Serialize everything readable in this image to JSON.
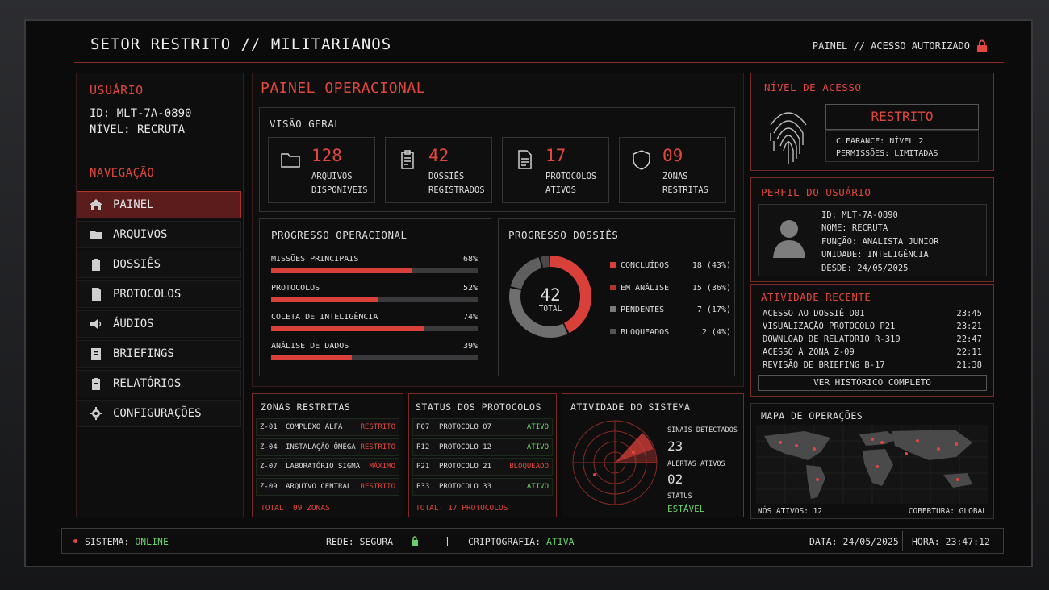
{
  "header": {
    "title": "SETOR RESTRITO // MILITARIANOS",
    "access": "PAINEL // ACESSO AUTORIZADO"
  },
  "user": {
    "heading": "USUÁRIO",
    "id": "ID: MLT-7A-0890",
    "level": "NÍVEL: RECRUTA"
  },
  "nav": {
    "heading": "NAVEGAÇÃO",
    "items": [
      {
        "label": "PAINEL",
        "icon": "home-icon"
      },
      {
        "label": "ARQUIVOS",
        "icon": "folder-icon"
      },
      {
        "label": "DOSSIÊS",
        "icon": "clipboard-icon"
      },
      {
        "label": "PROTOCOLOS",
        "icon": "document-icon"
      },
      {
        "label": "ÁUDIOS",
        "icon": "speaker-icon"
      },
      {
        "label": "BRIEFINGS",
        "icon": "briefing-icon"
      },
      {
        "label": "RELATÓRIOS",
        "icon": "report-icon"
      },
      {
        "label": "CONFIGURAÇÕES",
        "icon": "gear-icon"
      }
    ]
  },
  "main": {
    "title": "PAINEL OPERACIONAL",
    "overview": {
      "heading": "VISÃO GERAL",
      "stats": [
        {
          "value": "128",
          "line1": "ARQUIVOS",
          "line2": "DISPONÍVEIS",
          "icon": "folder-icon"
        },
        {
          "value": "42",
          "line1": "DOSSIÊS",
          "line2": "REGISTRADOS",
          "icon": "clipboard-icon"
        },
        {
          "value": "17",
          "line1": "PROTOCOLOS",
          "line2": "ATIVOS",
          "icon": "document-icon"
        },
        {
          "value": "09",
          "line1": "ZONAS",
          "line2": "RESTRITAS",
          "icon": "shield-icon"
        }
      ]
    }
  },
  "progress": {
    "heading": "PROGRESSO OPERACIONAL",
    "items": [
      {
        "label": "MISSÕES PRINCIPAIS",
        "pct": "68%",
        "value": 0.68
      },
      {
        "label": "PROTOCOLOS",
        "pct": "52%",
        "value": 0.52
      },
      {
        "label": "COLETA DE INTELIGÊNCIA",
        "pct": "74%",
        "value": 0.74
      },
      {
        "label": "ANÁLISE DE DADOS",
        "pct": "39%",
        "value": 0.39
      }
    ]
  },
  "dossies": {
    "heading": "PROGRESSO DOSSIÊS",
    "total": "42",
    "total_label": "TOTAL",
    "legend": [
      {
        "label": "CONCLUÍDOS",
        "value": "18 (43%)",
        "color": "#d9403a",
        "fraction": 0.43
      },
      {
        "label": "EM ANÁLISE",
        "value": "15 (36%)",
        "color": "#b3332d",
        "fraction": 0.36
      },
      {
        "label": "PENDENTES",
        "value": "7 (17%)",
        "color": "#7a7a7a",
        "fraction": 0.17
      },
      {
        "label": "BLOQUEADOS",
        "value": "2 (4%)",
        "color": "#555",
        "fraction": 0.04
      }
    ]
  },
  "zones": {
    "heading": "ZONAS RESTRITAS",
    "rows": [
      {
        "code": "Z-01",
        "name": "COMPLEXO ALFA",
        "status": "RESTRITO"
      },
      {
        "code": "Z-04",
        "name": "INSTALAÇÃO ÔMEGA",
        "status": "RESTRITO"
      },
      {
        "code": "Z-07",
        "name": "LABORATÓRIO SIGMA",
        "status": "MÁXIMO"
      },
      {
        "code": "Z-09",
        "name": "ARQUIVO CENTRAL",
        "status": "RESTRITO"
      }
    ],
    "total": "TOTAL: 09 ZONAS"
  },
  "protocols": {
    "heading": "STATUS DOS PROTOCOLOS",
    "rows": [
      {
        "code": "P07",
        "name": "PROTOCOLO 07",
        "status": "ATIVO"
      },
      {
        "code": "P12",
        "name": "PROTOCOLO 12",
        "status": "ATIVO"
      },
      {
        "code": "P21",
        "name": "PROTOCOLO 21",
        "status": "BLOQUEADO"
      },
      {
        "code": "P33",
        "name": "PROTOCOLO 33",
        "status": "ATIVO"
      }
    ],
    "total": "TOTAL: 17 PROTOCOLOS"
  },
  "system": {
    "heading": "ATIVIDADE DO SISTEMA",
    "signals_label": "SINAIS DETECTADOS",
    "signals": "23",
    "alerts_label": "ALERTAS ATIVOS",
    "alerts": "02",
    "status_label": "STATUS",
    "status": "ESTÁVEL"
  },
  "access": {
    "heading": "NÍVEL DE ACESSO",
    "level": "RESTRITO",
    "clearance": "CLEARANCE: NÍVEL 2",
    "permissions": "PERMISSÕES: LIMITADAS"
  },
  "profile": {
    "heading": "PERFIL DO USUÁRIO",
    "id": "ID: MLT-7A-0890",
    "name": "NOME: RECRUTA",
    "role": "FUNÇÃO: ANALISTA JUNIOR",
    "unit": "UNIDADE: INTELIGÊNCIA",
    "since": "DESDE: 24/05/2025"
  },
  "activity": {
    "heading": "ATIVIDADE RECENTE",
    "rows": [
      {
        "text": "ACESSO AO DOSSIÊ D01",
        "time": "23:45"
      },
      {
        "text": "VISUALIZAÇÃO PROTOCOLO P21",
        "time": "23:21"
      },
      {
        "text": "DOWNLOAD DE RELATÓRIO R-319",
        "time": "22:47"
      },
      {
        "text": "ACESSO À ZONA Z-09",
        "time": "22:11"
      },
      {
        "text": "REVISÃO DE BRIEFING B-17",
        "time": "21:38"
      }
    ],
    "button": "VER HISTÓRICO COMPLETO"
  },
  "map": {
    "heading": "MAPA DE OPERAÇÕES",
    "nodes": "NÓS ATIVOS: 12",
    "coverage": "COBERTURA: GLOBAL"
  },
  "footer": {
    "system_label": "SISTEMA:",
    "system": "ONLINE",
    "network": "REDE: SEGURA",
    "crypto_label": "CRIPTOGRAFIA:",
    "crypto": "ATIVA",
    "date": "DATA: 24/05/2025",
    "time": "HORA: 23:47:12",
    "separator": "|"
  },
  "colors": {
    "accent": "#e2473f",
    "ok": "#6ad06a"
  }
}
